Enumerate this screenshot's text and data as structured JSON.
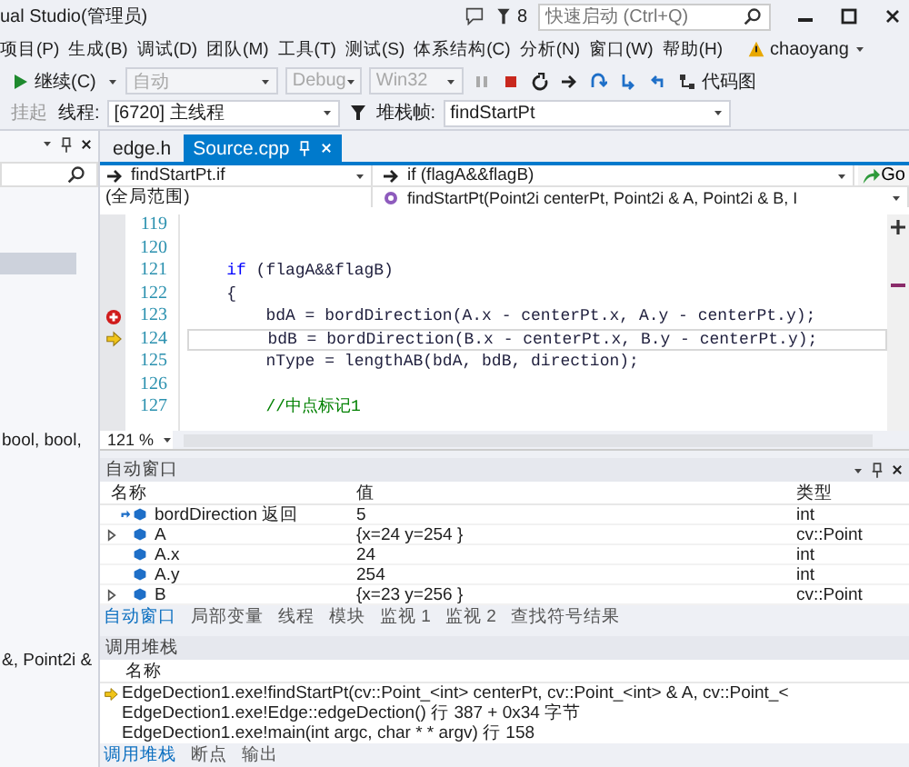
{
  "window": {
    "title": "ual Studio(管理员)",
    "notification_count": "8",
    "quick_launch": {
      "placeholder": "快速启动 (Ctrl+Q)"
    }
  },
  "menu": [
    "项目(P)",
    "生成(B)",
    "调试(D)",
    "团队(M)",
    "工具(T)",
    "测试(S)",
    "体系结构(C)",
    "分析(N)",
    "窗口(W)",
    "帮助(H)"
  ],
  "account": {
    "user": "chaoyang",
    "warning": true
  },
  "toolbar": {
    "continue": "继续(C)",
    "dropdowns": [
      {
        "value": "自动",
        "disabled": true
      },
      {
        "value": "Debug",
        "disabled": true
      },
      {
        "value": "Win32",
        "disabled": true
      }
    ],
    "code_map": "代码图"
  },
  "debug_location": {
    "suspend": {
      "label": "挂起",
      "disabled": true
    },
    "thread_label": "线程:",
    "thread": "[6720] 主线程",
    "frame_label": "堆栈帧:",
    "frame": "findStartPt"
  },
  "side_panel": {
    "texts": [
      "bool, bool,",
      "&, Point2i &"
    ]
  },
  "editor": {
    "tabs": [
      {
        "label": "edge.h",
        "selected": false
      },
      {
        "label": "Source.cpp",
        "selected": true
      }
    ],
    "scope": "findStartPt.if",
    "block": "if (flagA&&flagB)",
    "go": "Go",
    "context": "(全局范围)",
    "member": "findStartPt(Point2i centerPt, Point2i & A, Point2i & B, I",
    "lines": [
      {
        "number": "119",
        "breakpoint": false,
        "current": false
      },
      {
        "number": "120",
        "breakpoint": false,
        "current": false
      },
      {
        "number": "121",
        "breakpoint": false,
        "current": false,
        "tokens": [
          {
            "text": "    if",
            "kind": "keyword"
          },
          {
            "text": " (flagA&&flagB)",
            "kind": "plain"
          }
        ]
      },
      {
        "number": "122",
        "breakpoint": false,
        "current": false,
        "tokens": [
          {
            "text": "    {",
            "kind": "plain"
          }
        ]
      },
      {
        "number": "123",
        "breakpoint": true,
        "current": false,
        "tokens": [
          {
            "text": "        bdA = bordDirection(A.x - centerPt.x, A.y - centerPt.y);",
            "kind": "plain"
          }
        ]
      },
      {
        "number": "124",
        "breakpoint": false,
        "current": true,
        "tokens": [
          {
            "text": "        bdB = bordDirection(B.x - centerPt.x, B.y - centerPt.y);",
            "kind": "plain"
          }
        ]
      },
      {
        "number": "125",
        "breakpoint": false,
        "current": false,
        "tokens": [
          {
            "text": "        nType = lengthAB(bdA, bdB, direction);",
            "kind": "plain"
          }
        ]
      },
      {
        "number": "126",
        "breakpoint": false,
        "current": false
      },
      {
        "number": "127",
        "breakpoint": false,
        "current": false,
        "tokens": [
          {
            "text": "        //中点标记1",
            "kind": "comment"
          }
        ]
      }
    ],
    "zoom": "121 %"
  },
  "autos": {
    "title": "自动窗口",
    "columns": [
      "名称",
      "值",
      "类型"
    ],
    "rows": [
      {
        "kind": "return",
        "expandable": false,
        "name": "bordDirection 返回",
        "value": "5",
        "type": "int"
      },
      {
        "kind": "variable",
        "expandable": true,
        "name": "A",
        "value": "{x=24 y=254 }",
        "type": "cv::Point"
      },
      {
        "kind": "variable",
        "expandable": false,
        "name": "A.x",
        "value": "24",
        "type": "int"
      },
      {
        "kind": "variable",
        "expandable": false,
        "name": "A.y",
        "value": "254",
        "type": "int"
      },
      {
        "kind": "variable",
        "expandable": true,
        "name": "B",
        "value": "{x=23 y=256 }",
        "type": "cv::Point"
      }
    ],
    "tabs": [
      {
        "label": "自动窗口",
        "selected": true
      },
      {
        "label": "局部变量",
        "selected": false
      },
      {
        "label": "线程",
        "selected": false
      },
      {
        "label": "模块",
        "selected": false
      },
      {
        "label": "监视 1",
        "selected": false
      },
      {
        "label": "监视 2",
        "selected": false
      },
      {
        "label": "查找符号结果",
        "selected": false
      }
    ]
  },
  "call_stack": {
    "title": "调用堆栈",
    "columns": [
      "名称"
    ],
    "rows": [
      {
        "text": "EdgeDection1.exe!findStartPt(cv::Point_<int> centerPt, cv::Point_<int> & A, cv::Point_<",
        "current": true
      },
      {
        "text": "EdgeDection1.exe!Edge::edgeDection() 行 387 + 0x34 字节",
        "current": false
      },
      {
        "text": "EdgeDection1.exe!main(int argc, char * * argv) 行 158",
        "current": false
      }
    ],
    "tabs": [
      {
        "label": "调用堆栈",
        "selected": true
      },
      {
        "label": "断点",
        "selected": false
      },
      {
        "label": "输出",
        "selected": false
      }
    ]
  }
}
